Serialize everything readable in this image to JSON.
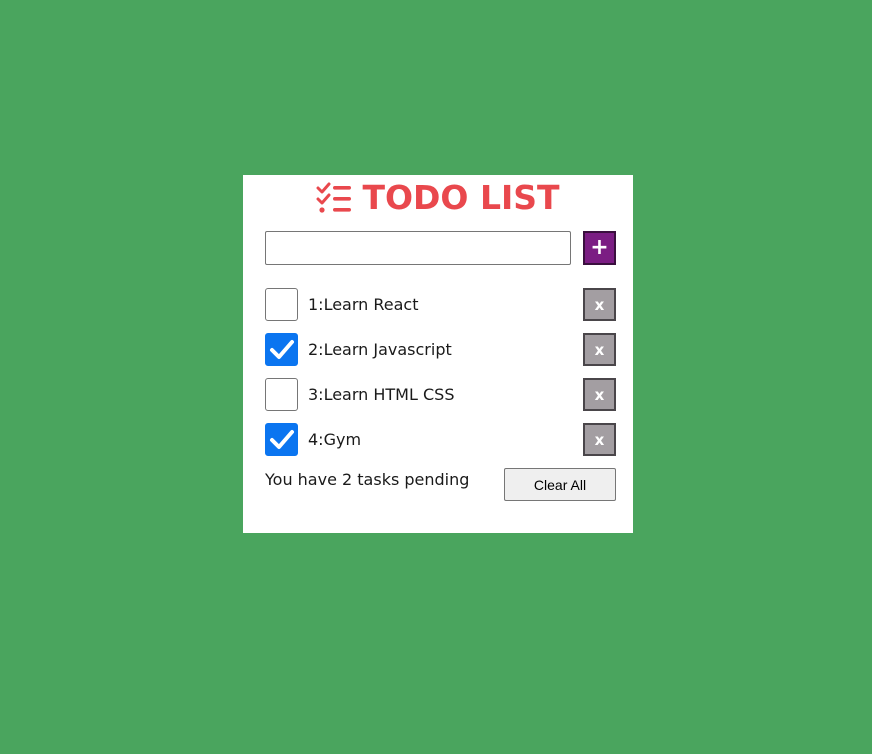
{
  "app": {
    "title": "TODO LIST",
    "title_icon": "list-check-icon",
    "accent_color": "#e9484d",
    "background_color": "#4aa55e"
  },
  "input": {
    "value": "",
    "placeholder": ""
  },
  "add_button": {
    "label": "+",
    "color": "#7b1d83"
  },
  "tasks": [
    {
      "label": "1:Learn React",
      "checked": false,
      "delete_label": "x"
    },
    {
      "label": "2:Learn Javascript",
      "checked": true,
      "delete_label": "x"
    },
    {
      "label": "3:Learn HTML CSS",
      "checked": false,
      "delete_label": "x"
    },
    {
      "label": "4:Gym",
      "checked": true,
      "delete_label": "x"
    }
  ],
  "footer": {
    "pending_text": "You have 2 tasks pending",
    "clear_label": "Clear All"
  }
}
